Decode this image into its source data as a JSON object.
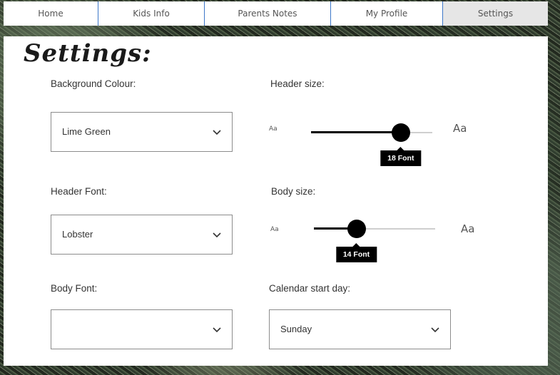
{
  "nav": {
    "items": [
      {
        "label": "Home"
      },
      {
        "label": "Kids Info"
      },
      {
        "label": "Parents Notes"
      },
      {
        "label": "My Profile"
      },
      {
        "label": "Settings"
      }
    ]
  },
  "page": {
    "title": "Settings:"
  },
  "settings": {
    "background_colour": {
      "label": "Background Colour:",
      "value": "Lime Green"
    },
    "header_font": {
      "label": "Header Font:",
      "value": "Lobster"
    },
    "body_font": {
      "label": "Body Font:",
      "value": ""
    },
    "header_size": {
      "label": "Header size:",
      "min_label": "Aa",
      "max_label": "Aa",
      "tooltip": "18 Font",
      "level_fraction": 0.74
    },
    "body_size": {
      "label": "Body size:",
      "min_label": "Aa",
      "max_label": "Aa",
      "tooltip": "14 Font",
      "level_fraction": 0.35
    },
    "calendar_start_day": {
      "label": "Calendar start day:",
      "value": "Sunday"
    }
  },
  "icons": {
    "chevron": "chevron-down-icon",
    "slider_thumb": "slider-thumb"
  },
  "colors": {
    "nav_divider": "#3d77c9",
    "active_tab_bg": "#e6e6e6",
    "slider_fill": "#000000",
    "slider_track": "#cfcfcf"
  }
}
